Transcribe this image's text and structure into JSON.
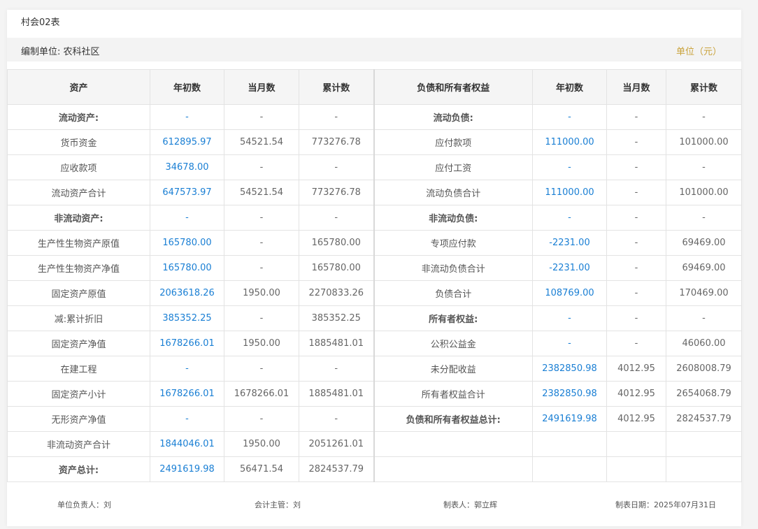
{
  "form_code": "村会02表",
  "unit_bar": {
    "org": "编制单位: 农科社区",
    "unit": "单位（元）"
  },
  "headers": [
    "资产",
    "年初数",
    "当月数",
    "累计数",
    "负债和所有者权益",
    "年初数",
    "当月数",
    "累计数"
  ],
  "rows": [
    [
      {
        "t": "流动资产:",
        "s": "bold"
      },
      {
        "t": "-",
        "s": "blue"
      },
      {
        "t": "-",
        "s": "num"
      },
      {
        "t": "-",
        "s": "num"
      },
      {
        "t": "流动负债:",
        "s": "bold"
      },
      {
        "t": "-",
        "s": "blue"
      },
      {
        "t": "-",
        "s": "num"
      },
      {
        "t": "-",
        "s": "num"
      }
    ],
    [
      {
        "t": "货币资金",
        "s": "label"
      },
      {
        "t": "612895.97",
        "s": "blue"
      },
      {
        "t": "54521.54",
        "s": "num"
      },
      {
        "t": "773276.78",
        "s": "num"
      },
      {
        "t": "应付款项",
        "s": "label"
      },
      {
        "t": "111000.00",
        "s": "blue"
      },
      {
        "t": "-",
        "s": "num"
      },
      {
        "t": "101000.00",
        "s": "num"
      }
    ],
    [
      {
        "t": "应收款项",
        "s": "label"
      },
      {
        "t": "34678.00",
        "s": "blue"
      },
      {
        "t": "-",
        "s": "num"
      },
      {
        "t": "-",
        "s": "num"
      },
      {
        "t": "应付工资",
        "s": "label"
      },
      {
        "t": "-",
        "s": "blue"
      },
      {
        "t": "-",
        "s": "num"
      },
      {
        "t": "-",
        "s": "num"
      }
    ],
    [
      {
        "t": "流动资产合计",
        "s": "label"
      },
      {
        "t": "647573.97",
        "s": "blue"
      },
      {
        "t": "54521.54",
        "s": "num"
      },
      {
        "t": "773276.78",
        "s": "num"
      },
      {
        "t": "流动负债合计",
        "s": "label"
      },
      {
        "t": "111000.00",
        "s": "blue"
      },
      {
        "t": "-",
        "s": "num"
      },
      {
        "t": "101000.00",
        "s": "num"
      }
    ],
    [
      {
        "t": "非流动资产:",
        "s": "bold"
      },
      {
        "t": "-",
        "s": "blue"
      },
      {
        "t": "-",
        "s": "num"
      },
      {
        "t": "-",
        "s": "num"
      },
      {
        "t": "非流动负债:",
        "s": "bold"
      },
      {
        "t": "-",
        "s": "blue"
      },
      {
        "t": "-",
        "s": "num"
      },
      {
        "t": "-",
        "s": "num"
      }
    ],
    [
      {
        "t": "生产性生物资产原值",
        "s": "label"
      },
      {
        "t": "165780.00",
        "s": "blue"
      },
      {
        "t": "-",
        "s": "num"
      },
      {
        "t": "165780.00",
        "s": "num"
      },
      {
        "t": "专项应付款",
        "s": "label"
      },
      {
        "t": "-2231.00",
        "s": "blue"
      },
      {
        "t": "-",
        "s": "num"
      },
      {
        "t": "69469.00",
        "s": "num"
      }
    ],
    [
      {
        "t": "生产性生物资产净值",
        "s": "label"
      },
      {
        "t": "165780.00",
        "s": "blue"
      },
      {
        "t": "-",
        "s": "num"
      },
      {
        "t": "165780.00",
        "s": "num"
      },
      {
        "t": "非流动负债合计",
        "s": "label"
      },
      {
        "t": "-2231.00",
        "s": "blue"
      },
      {
        "t": "-",
        "s": "num"
      },
      {
        "t": "69469.00",
        "s": "num"
      }
    ],
    [
      {
        "t": "固定资产原值",
        "s": "label"
      },
      {
        "t": "2063618.26",
        "s": "blue"
      },
      {
        "t": "1950.00",
        "s": "num"
      },
      {
        "t": "2270833.26",
        "s": "num"
      },
      {
        "t": "负债合计",
        "s": "label"
      },
      {
        "t": "108769.00",
        "s": "blue"
      },
      {
        "t": "-",
        "s": "num"
      },
      {
        "t": "170469.00",
        "s": "num"
      }
    ],
    [
      {
        "t": "减:累计折旧",
        "s": "label"
      },
      {
        "t": "385352.25",
        "s": "blue"
      },
      {
        "t": "-",
        "s": "num"
      },
      {
        "t": "385352.25",
        "s": "num"
      },
      {
        "t": "所有者权益:",
        "s": "bold"
      },
      {
        "t": "-",
        "s": "blue"
      },
      {
        "t": "-",
        "s": "num"
      },
      {
        "t": "-",
        "s": "num"
      }
    ],
    [
      {
        "t": "固定资产净值",
        "s": "label"
      },
      {
        "t": "1678266.01",
        "s": "blue"
      },
      {
        "t": "1950.00",
        "s": "num"
      },
      {
        "t": "1885481.01",
        "s": "num"
      },
      {
        "t": "公积公益金",
        "s": "label"
      },
      {
        "t": "-",
        "s": "blue"
      },
      {
        "t": "-",
        "s": "num"
      },
      {
        "t": "46060.00",
        "s": "num"
      }
    ],
    [
      {
        "t": "在建工程",
        "s": "label"
      },
      {
        "t": "-",
        "s": "blue"
      },
      {
        "t": "-",
        "s": "num"
      },
      {
        "t": "-",
        "s": "num"
      },
      {
        "t": "未分配收益",
        "s": "label"
      },
      {
        "t": "2382850.98",
        "s": "blue"
      },
      {
        "t": "4012.95",
        "s": "num"
      },
      {
        "t": "2608008.79",
        "s": "num"
      }
    ],
    [
      {
        "t": "固定资产小计",
        "s": "label"
      },
      {
        "t": "1678266.01",
        "s": "blue"
      },
      {
        "t": "1678266.01",
        "s": "num"
      },
      {
        "t": "1885481.01",
        "s": "num"
      },
      {
        "t": "所有者权益合计",
        "s": "label"
      },
      {
        "t": "2382850.98",
        "s": "blue"
      },
      {
        "t": "4012.95",
        "s": "num"
      },
      {
        "t": "2654068.79",
        "s": "num"
      }
    ],
    [
      {
        "t": "无形资产净值",
        "s": "label"
      },
      {
        "t": "-",
        "s": "blue"
      },
      {
        "t": "-",
        "s": "num"
      },
      {
        "t": "-",
        "s": "num"
      },
      {
        "t": "负债和所有者权益总计:",
        "s": "bold"
      },
      {
        "t": "2491619.98",
        "s": "blue"
      },
      {
        "t": "4012.95",
        "s": "num"
      },
      {
        "t": "2824537.79",
        "s": "num"
      }
    ],
    [
      {
        "t": "非流动资产合计",
        "s": "label"
      },
      {
        "t": "1844046.01",
        "s": "blue"
      },
      {
        "t": "1950.00",
        "s": "num"
      },
      {
        "t": "2051261.01",
        "s": "num"
      },
      {
        "t": "",
        "s": "label"
      },
      {
        "t": "",
        "s": "blue"
      },
      {
        "t": "",
        "s": "num"
      },
      {
        "t": "",
        "s": "num"
      }
    ],
    [
      {
        "t": "资产总计:",
        "s": "bold"
      },
      {
        "t": "2491619.98",
        "s": "blue"
      },
      {
        "t": "56471.54",
        "s": "num"
      },
      {
        "t": "2824537.79",
        "s": "num"
      },
      {
        "t": "",
        "s": "label"
      },
      {
        "t": "",
        "s": "blue"
      },
      {
        "t": "",
        "s": "num"
      },
      {
        "t": "",
        "s": "num"
      }
    ]
  ],
  "footer": {
    "unit_head": "单位负责人：刘",
    "accountant": "会计主管：刘",
    "preparer": "制表人：郭立辉",
    "date": "制表日期：2025年07月31日"
  }
}
